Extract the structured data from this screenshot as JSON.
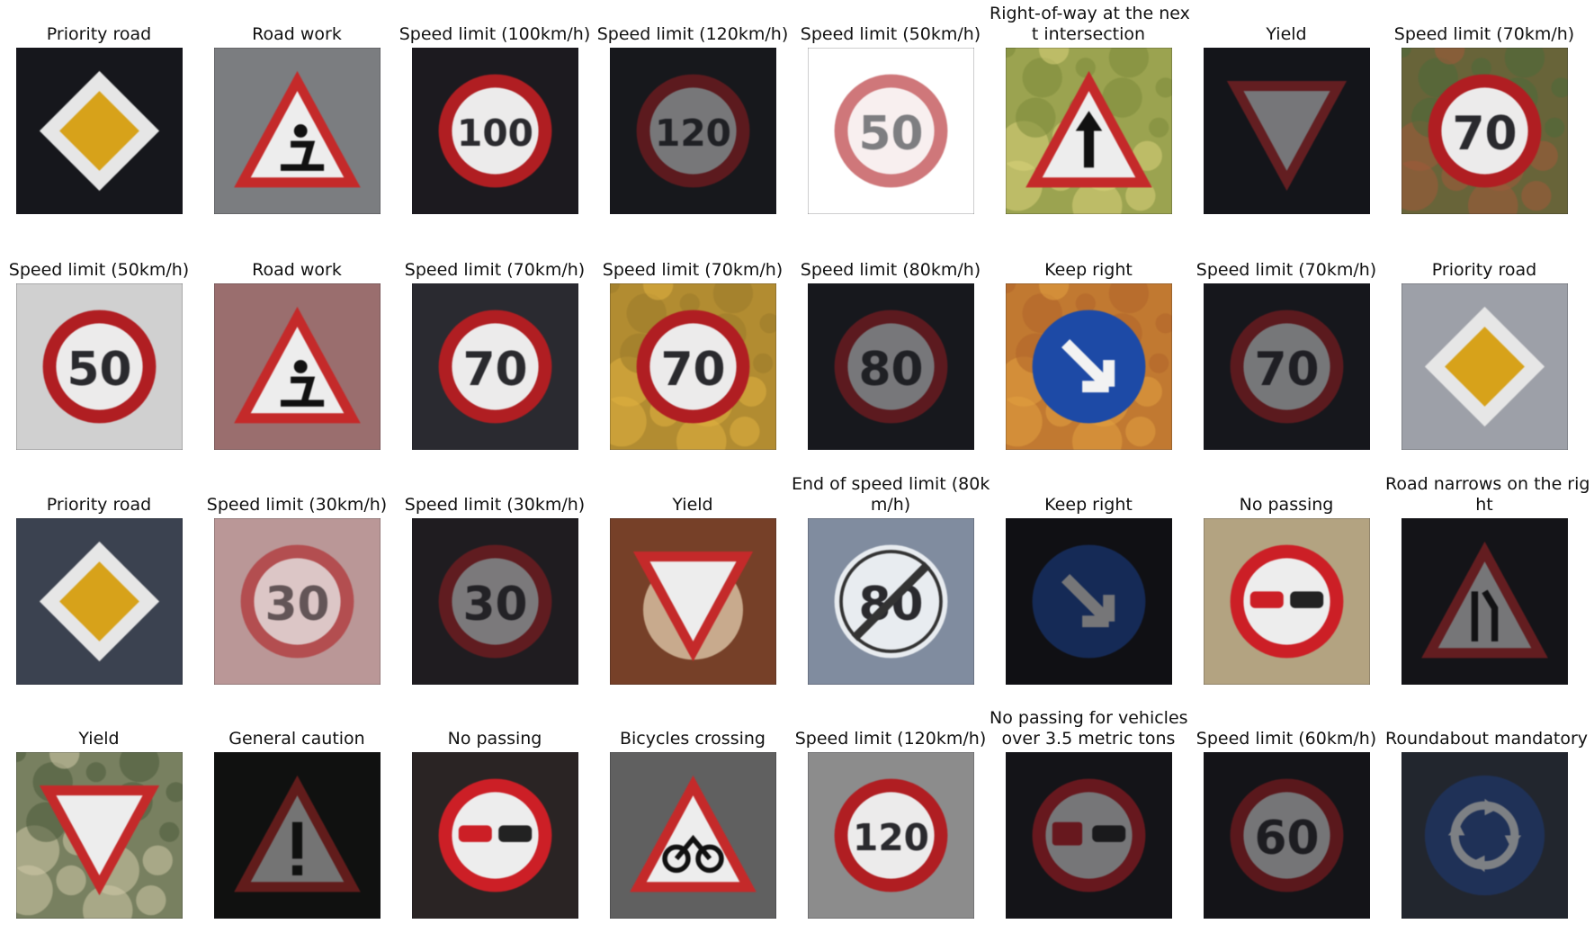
{
  "grid": {
    "rows": [
      {
        "cells": [
          {
            "title_lines": [
              "Priority road"
            ],
            "image": "priority-road-sign"
          },
          {
            "title_lines": [
              "Road work"
            ],
            "image": "road-work-sign"
          },
          {
            "title_lines": [
              "Speed limit (100km/h)"
            ],
            "image": "speed-limit-sign",
            "sign_text": "100"
          },
          {
            "title_lines": [
              "Speed limit (120km/h)"
            ],
            "image": "speed-limit-sign",
            "sign_text": "120"
          },
          {
            "title_lines": [
              "Speed limit (50km/h)"
            ],
            "image": "speed-limit-sign",
            "sign_text": "50"
          },
          {
            "title_lines": [
              "Right-of-way at the nex",
              "t intersection"
            ],
            "image": "right-of-way-sign"
          },
          {
            "title_lines": [
              "Yield"
            ],
            "image": "yield-sign"
          },
          {
            "title_lines": [
              "Speed limit (70km/h)"
            ],
            "image": "speed-limit-sign",
            "sign_text": "70"
          }
        ]
      },
      {
        "cells": [
          {
            "title_lines": [
              "Speed limit (50km/h)"
            ],
            "image": "speed-limit-sign",
            "sign_text": "50"
          },
          {
            "title_lines": [
              "Road work"
            ],
            "image": "road-work-sign"
          },
          {
            "title_lines": [
              "Speed limit (70km/h)"
            ],
            "image": "speed-limit-sign",
            "sign_text": "70"
          },
          {
            "title_lines": [
              "Speed limit (70km/h)"
            ],
            "image": "speed-limit-sign",
            "sign_text": "70"
          },
          {
            "title_lines": [
              "Speed limit (80km/h)"
            ],
            "image": "speed-limit-sign",
            "sign_text": "80"
          },
          {
            "title_lines": [
              "Keep right"
            ],
            "image": "keep-right-sign"
          },
          {
            "title_lines": [
              "Speed limit (70km/h)"
            ],
            "image": "speed-limit-sign",
            "sign_text": "70"
          },
          {
            "title_lines": [
              "Priority road"
            ],
            "image": "priority-road-sign"
          }
        ]
      },
      {
        "cells": [
          {
            "title_lines": [
              "Priority road"
            ],
            "image": "priority-road-sign"
          },
          {
            "title_lines": [
              "Speed limit (30km/h)"
            ],
            "image": "speed-limit-sign",
            "sign_text": "30"
          },
          {
            "title_lines": [
              "Speed limit (30km/h)"
            ],
            "image": "speed-limit-sign",
            "sign_text": "30"
          },
          {
            "title_lines": [
              "Yield"
            ],
            "image": "yield-sign"
          },
          {
            "title_lines": [
              "End of speed limit (80k",
              "m/h)"
            ],
            "image": "end-speed-limit-sign",
            "sign_text": "80"
          },
          {
            "title_lines": [
              "Keep right"
            ],
            "image": "keep-right-sign"
          },
          {
            "title_lines": [
              "No passing"
            ],
            "image": "no-passing-sign"
          },
          {
            "title_lines": [
              "Road narrows on the rig",
              "ht"
            ],
            "image": "road-narrows-sign"
          }
        ]
      },
      {
        "cells": [
          {
            "title_lines": [
              "Yield"
            ],
            "image": "yield-sign"
          },
          {
            "title_lines": [
              "General caution"
            ],
            "image": "general-caution-sign"
          },
          {
            "title_lines": [
              "No passing"
            ],
            "image": "no-passing-sign"
          },
          {
            "title_lines": [
              "Bicycles crossing"
            ],
            "image": "bicycles-crossing-sign"
          },
          {
            "title_lines": [
              "Speed limit (120km/h)"
            ],
            "image": "speed-limit-sign",
            "sign_text": "120"
          },
          {
            "title_lines": [
              "No passing for vehicles",
              "over 3.5 metric tons"
            ],
            "image": "no-passing-trucks-sign"
          },
          {
            "title_lines": [
              "Speed limit (60km/h)"
            ],
            "image": "speed-limit-sign",
            "sign_text": "60"
          },
          {
            "title_lines": [
              "Roundabout mandatory"
            ],
            "image": "roundabout-sign"
          }
        ]
      }
    ]
  }
}
